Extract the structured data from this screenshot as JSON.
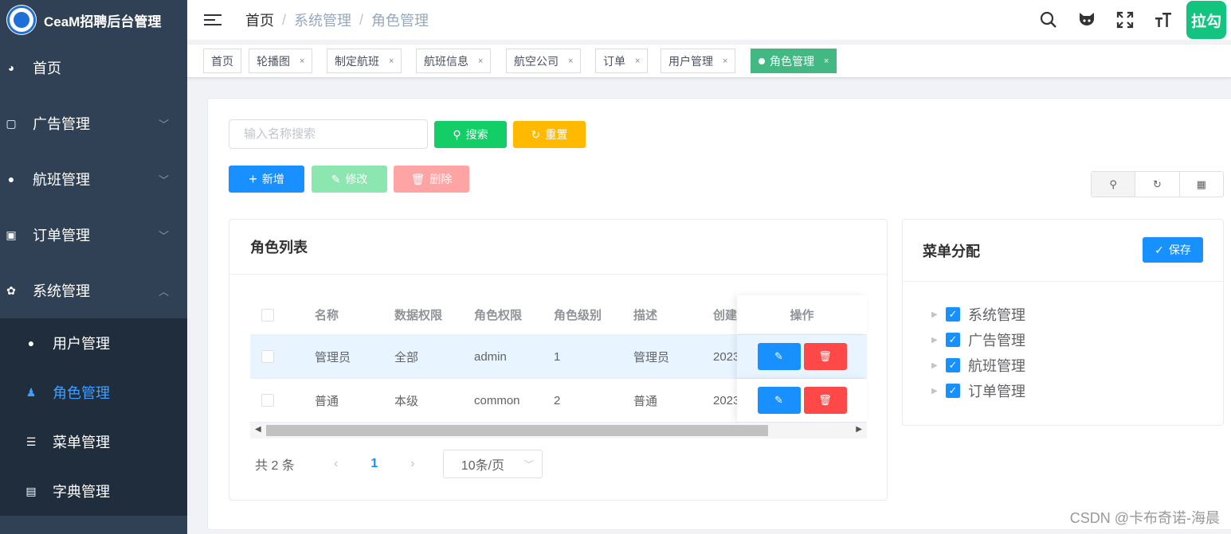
{
  "app": {
    "title": "CeaM招聘后台管理"
  },
  "sidebar": {
    "items": [
      {
        "label": "首页",
        "icon": "dashboard-icon"
      },
      {
        "label": "广告管理",
        "icon": "ad-icon",
        "arrow": "﹀"
      },
      {
        "label": "航班管理",
        "icon": "people-icon",
        "arrow": "﹀"
      },
      {
        "label": "订单管理",
        "icon": "lock-icon",
        "arrow": "﹀"
      },
      {
        "label": "系统管理",
        "icon": "gear-icon",
        "arrow": "︿"
      }
    ],
    "subitems": [
      {
        "label": "用户管理",
        "icon": "user-icon"
      },
      {
        "label": "角色管理",
        "icon": "role-icon",
        "active": true
      },
      {
        "label": "菜单管理",
        "icon": "list-icon"
      },
      {
        "label": "字典管理",
        "icon": "dict-icon"
      }
    ]
  },
  "header": {
    "breadcrumb": [
      "首页",
      "系统管理",
      "角色管理"
    ],
    "sep": "/",
    "avatar_text": "拉勾"
  },
  "tags": [
    {
      "label": "首页",
      "close": ""
    },
    {
      "label": "轮播图",
      "close": "×"
    },
    {
      "label": "制定航班",
      "close": "×"
    },
    {
      "label": "航班信息",
      "close": "×"
    },
    {
      "label": "航空公司",
      "close": "×"
    },
    {
      "label": "订单",
      "close": "×"
    },
    {
      "label": "用户管理",
      "close": "×"
    },
    {
      "label": "角色管理",
      "close": "×",
      "active": true
    }
  ],
  "toolbar": {
    "search_placeholder": "输入名称搜索",
    "search_label": "搜索",
    "reset_label": "重置",
    "add_label": "新增",
    "edit_label": "修改",
    "delete_label": "删除"
  },
  "role_list": {
    "title": "角色列表",
    "columns": [
      "名称",
      "数据权限",
      "角色权限",
      "角色级别",
      "描述",
      "创建",
      "操作"
    ],
    "rows": [
      {
        "name": "管理员",
        "data_scope": "全部",
        "role_key": "admin",
        "level": "1",
        "desc": "管理员",
        "created": "2023"
      },
      {
        "name": "普通",
        "data_scope": "本级",
        "role_key": "common",
        "level": "2",
        "desc": "普通",
        "created": "2023"
      }
    ],
    "pagination": {
      "total_text": "共 2 条",
      "prev": "‹",
      "current": "1",
      "next": "›",
      "page_size": "10条/页"
    }
  },
  "menu_assign": {
    "title": "菜单分配",
    "save_label": "保存",
    "tree": [
      "系统管理",
      "广告管理",
      "航班管理",
      "订单管理"
    ]
  },
  "watermark": "CSDN @卡布奇诺-海晨",
  "colors": {
    "sidebar": "#304156",
    "primary": "#1890ff",
    "success": "#13ce66",
    "warning": "#ffba00",
    "danger": "#ff4949",
    "tag_active": "#42b983"
  }
}
